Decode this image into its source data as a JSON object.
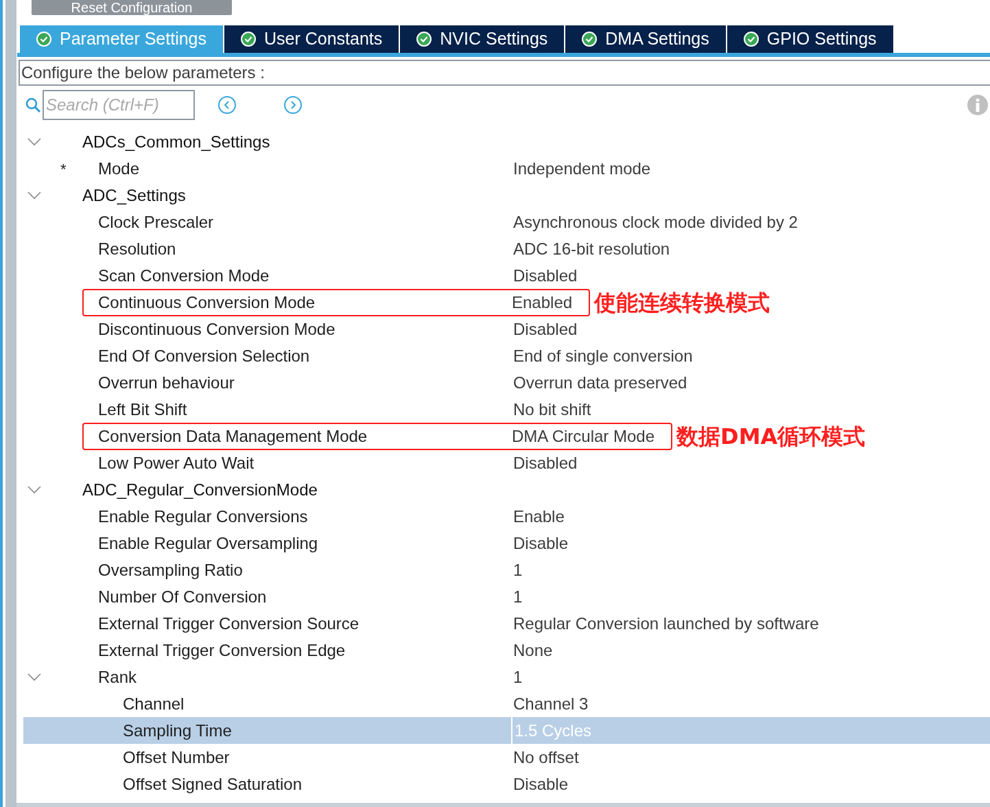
{
  "reset_button": {
    "label": "Reset Configuration"
  },
  "tabs": [
    {
      "label": "Parameter Settings",
      "selected": true
    },
    {
      "label": "User Constants",
      "selected": false
    },
    {
      "label": "NVIC Settings",
      "selected": false
    },
    {
      "label": "DMA Settings",
      "selected": false
    },
    {
      "label": "GPIO Settings",
      "selected": false
    }
  ],
  "instruction": "Configure the below parameters :",
  "search": {
    "placeholder": "Search (Ctrl+F)"
  },
  "tree": [
    {
      "name": "ADCs_Common_Settings",
      "expanded": true,
      "selected": false,
      "children": [
        {
          "name": "Mode",
          "value": "Independent mode",
          "marker": "*",
          "selected": false
        }
      ]
    },
    {
      "name": "ADC_Settings",
      "expanded": true,
      "selected": false,
      "children": [
        {
          "name": "Clock Prescaler",
          "value": "Asynchronous clock mode divided by 2",
          "selected": false
        },
        {
          "name": "Resolution",
          "value": "ADC 16-bit resolution",
          "selected": false
        },
        {
          "name": "Scan Conversion Mode",
          "value": "Disabled",
          "selected": false
        },
        {
          "name": "Continuous Conversion Mode",
          "value": "Enabled",
          "selected": false,
          "highlighted": true,
          "annotation": "使能连续转换模式"
        },
        {
          "name": "Discontinuous Conversion Mode",
          "value": "Disabled",
          "selected": false
        },
        {
          "name": "End Of Conversion Selection",
          "value": "End of single conversion",
          "selected": false
        },
        {
          "name": "Overrun behaviour",
          "value": "Overrun data preserved",
          "selected": false
        },
        {
          "name": "Left Bit Shift",
          "value": "No bit shift",
          "selected": false
        },
        {
          "name": "Conversion Data Management Mode",
          "value": "DMA Circular Mode",
          "selected": false,
          "highlighted": true,
          "annotation": "数据DMA循环模式"
        },
        {
          "name": "Low Power Auto Wait",
          "value": "Disabled",
          "selected": false
        }
      ]
    },
    {
      "name": "ADC_Regular_ConversionMode",
      "expanded": true,
      "selected": false,
      "children": [
        {
          "name": "Enable Regular Conversions",
          "value": "Enable",
          "selected": false
        },
        {
          "name": "Enable Regular Oversampling",
          "value": "Disable",
          "selected": false
        },
        {
          "name": "Oversampling Ratio",
          "value": "1",
          "selected": false
        },
        {
          "name": "Number Of Conversion",
          "value": "1",
          "selected": false
        },
        {
          "name": "External Trigger Conversion Source",
          "value": "Regular Conversion launched by software",
          "selected": false
        },
        {
          "name": "External Trigger Conversion Edge",
          "value": "None",
          "selected": false
        },
        {
          "name": "Rank",
          "value": "1",
          "expanded": true,
          "selected": false,
          "children": [
            {
              "name": "Channel",
              "value": "Channel 3",
              "selected": false
            },
            {
              "name": "Sampling Time",
              "value": "1.5 Cycles",
              "selected": true
            },
            {
              "name": "Offset Number",
              "value": "No offset",
              "selected": false
            },
            {
              "name": "Offset Signed Saturation",
              "value": "Disable",
              "selected": false
            }
          ]
        }
      ]
    }
  ]
}
